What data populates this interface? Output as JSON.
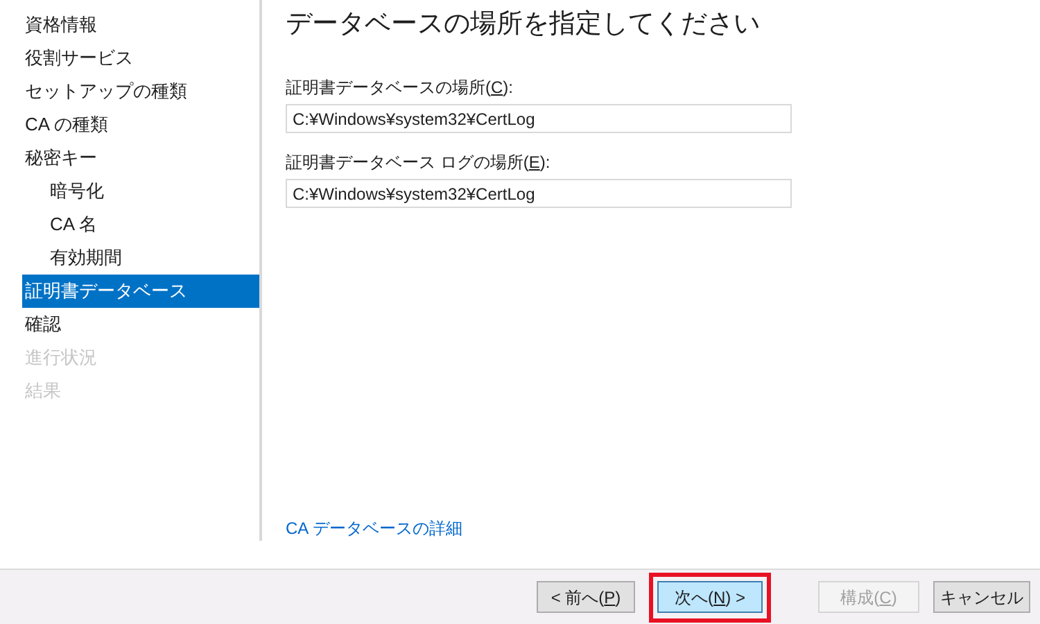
{
  "title": "データベースの場所を指定してください",
  "sidebar": {
    "items": [
      {
        "label": "資格情報",
        "selected": false,
        "disabled": false
      },
      {
        "label": "役割サービス",
        "selected": false,
        "disabled": false
      },
      {
        "label": "セットアップの種類",
        "selected": false,
        "disabled": false
      },
      {
        "label": "CA の種類",
        "selected": false,
        "disabled": false
      },
      {
        "label": "秘密キー",
        "selected": false,
        "disabled": false,
        "children": [
          {
            "label": "暗号化",
            "selected": false,
            "disabled": false
          },
          {
            "label": "CA 名",
            "selected": false,
            "disabled": false
          },
          {
            "label": "有効期間",
            "selected": false,
            "disabled": false
          }
        ]
      },
      {
        "label": "証明書データベース",
        "selected": true,
        "disabled": false
      },
      {
        "label": "確認",
        "selected": false,
        "disabled": false
      },
      {
        "label": "進行状況",
        "selected": false,
        "disabled": true
      },
      {
        "label": "結果",
        "selected": false,
        "disabled": true
      }
    ]
  },
  "fields": [
    {
      "label": [
        "証明書データベースの場所(",
        "C",
        "):"
      ],
      "value": "C:¥Windows¥system32¥CertLog"
    },
    {
      "label": [
        "証明書データベース ログの場所(",
        "E",
        "):"
      ],
      "value": "C:¥Windows¥system32¥CertLog"
    }
  ],
  "link": "CA データベースの詳細",
  "buttons": [
    {
      "label": [
        "< 前へ(",
        "P",
        ")"
      ],
      "disabled": false,
      "default": false,
      "highlighted": false
    },
    {
      "label": [
        "次へ(",
        "N",
        ") >"
      ],
      "disabled": false,
      "default": true,
      "highlighted": true
    },
    {
      "label": [
        "構成(",
        "C",
        ")"
      ],
      "disabled": true,
      "default": false,
      "highlighted": false
    },
    {
      "label": [
        "キャンセル"
      ],
      "disabled": false,
      "default": false,
      "highlighted": false
    }
  ]
}
